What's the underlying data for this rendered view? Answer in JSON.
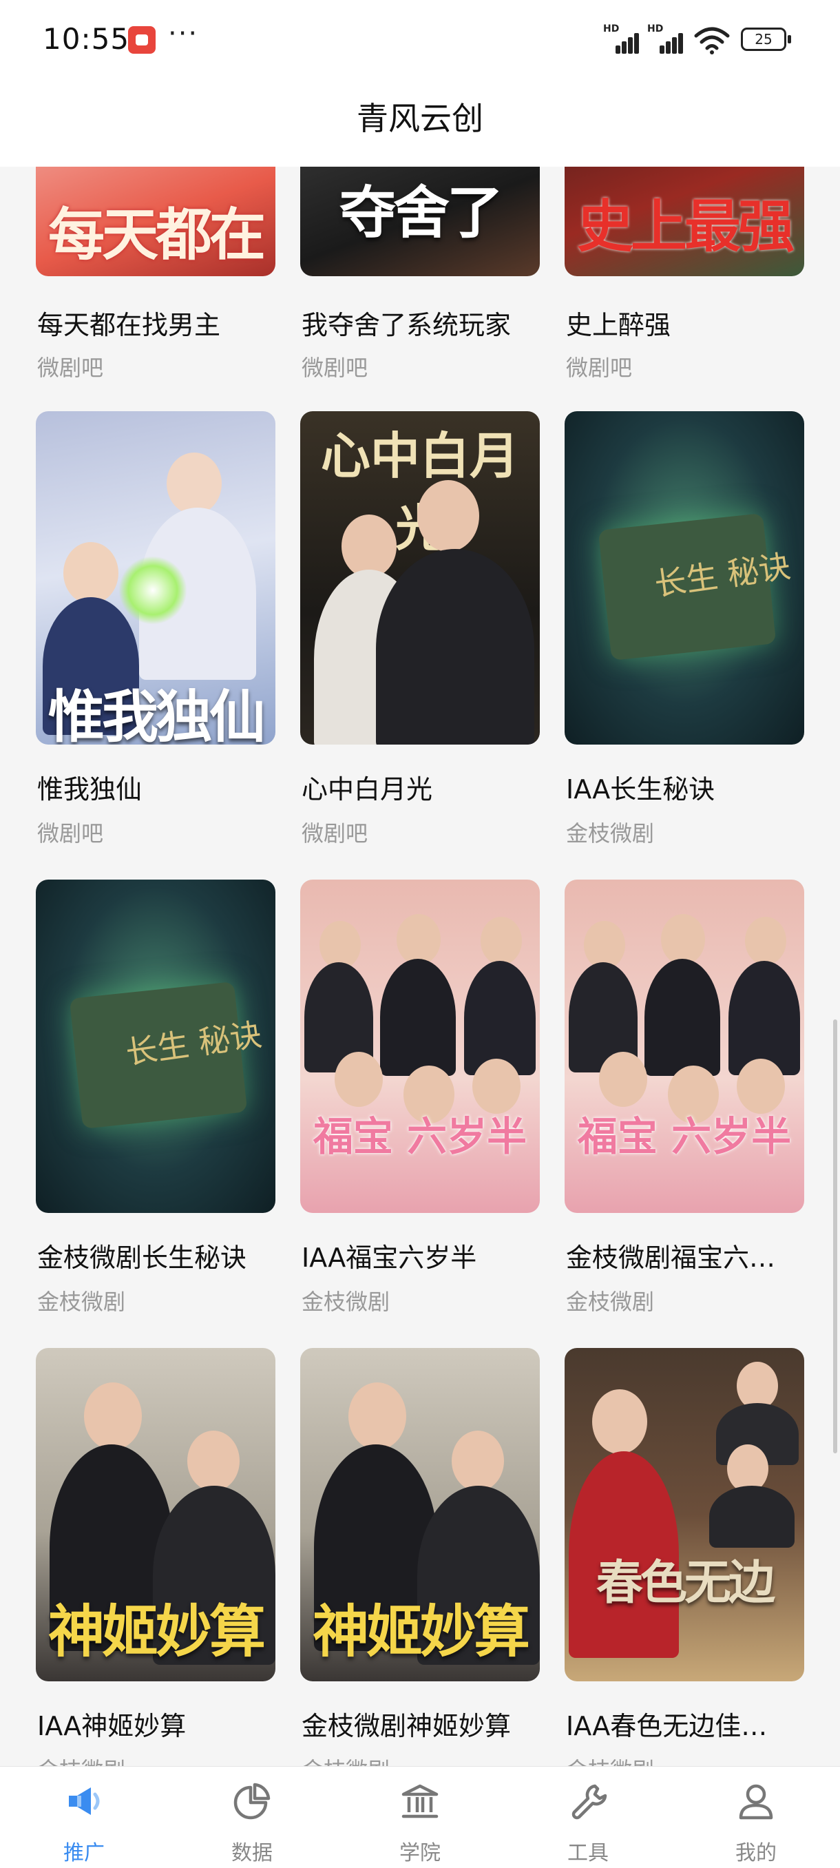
{
  "status_bar": {
    "time": "10:55",
    "dots": "···",
    "battery": "25"
  },
  "header": {
    "title": "青风云创"
  },
  "cards": [
    {
      "name": "每天都在找男主",
      "source": "微剧吧",
      "cover_text": "每天都在"
    },
    {
      "name": "我夺舍了系统玩家",
      "source": "微剧吧",
      "cover_text": "夺舍了"
    },
    {
      "name": "史上醉强",
      "source": "微剧吧",
      "cover_text": "史上最强"
    },
    {
      "name": "惟我独仙",
      "source": "微剧吧",
      "cover_text": "惟我独仙"
    },
    {
      "name": "心中白月光",
      "source": "微剧吧",
      "cover_text": "心中白月光"
    },
    {
      "name": "IAA长生秘诀",
      "source": "金枝微剧",
      "cover_text": "长生 秘诀"
    },
    {
      "name": "金枝微剧长生秘诀",
      "source": "金枝微剧",
      "cover_text": "长生 秘诀"
    },
    {
      "name": "IAA福宝六岁半",
      "source": "金枝微剧",
      "cover_text": "福宝 六岁半"
    },
    {
      "name": "金枝微剧福宝六…",
      "source": "金枝微剧",
      "cover_text": "福宝 六岁半"
    },
    {
      "name": "IAA神姬妙算",
      "source": "金枝微剧",
      "cover_text": "神姬妙算"
    },
    {
      "name": "金枝微剧神姬妙算",
      "source": "金枝微剧",
      "cover_text": "神姬妙算"
    },
    {
      "name": "IAA春色无边佳…",
      "source": "金枝微剧",
      "cover_text": "春色无边"
    }
  ],
  "nav": [
    {
      "label": "推广",
      "icon": "megaphone-icon",
      "active": true
    },
    {
      "label": "数据",
      "icon": "pie-chart-icon",
      "active": false
    },
    {
      "label": "学院",
      "icon": "school-building-icon",
      "active": false
    },
    {
      "label": "工具",
      "icon": "wrench-icon",
      "active": false
    },
    {
      "label": "我的",
      "icon": "person-icon",
      "active": false
    }
  ],
  "colors": {
    "accent": "#3a8cf0",
    "inactive": "#888888"
  }
}
